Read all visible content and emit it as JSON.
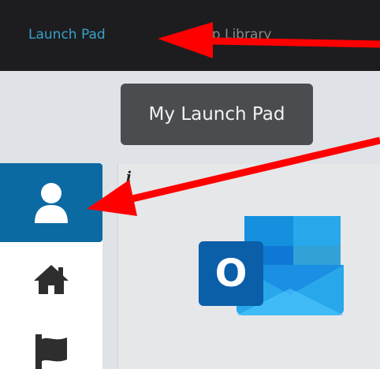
{
  "topbar": {
    "launch_pad_link": "Launch Pad",
    "app_library_partial": "pp Library"
  },
  "tooltip": {
    "text": "My Launch Pad"
  },
  "sidebar": {
    "items": [
      {
        "icon": "user-icon",
        "active": true
      },
      {
        "icon": "home-icon",
        "active": false
      },
      {
        "icon": "flag-icon",
        "active": false
      }
    ]
  },
  "tile": {
    "app": "Outlook",
    "app_letter": "O",
    "info_glyph": "i"
  },
  "annotations": {
    "arrow_color": "#ff0000"
  },
  "colors": {
    "topbar_bg": "#1d1d1f",
    "link": "#39a0c9",
    "sidebar_active": "#0b6aa2",
    "tooltip_bg": "#4a4d50"
  }
}
